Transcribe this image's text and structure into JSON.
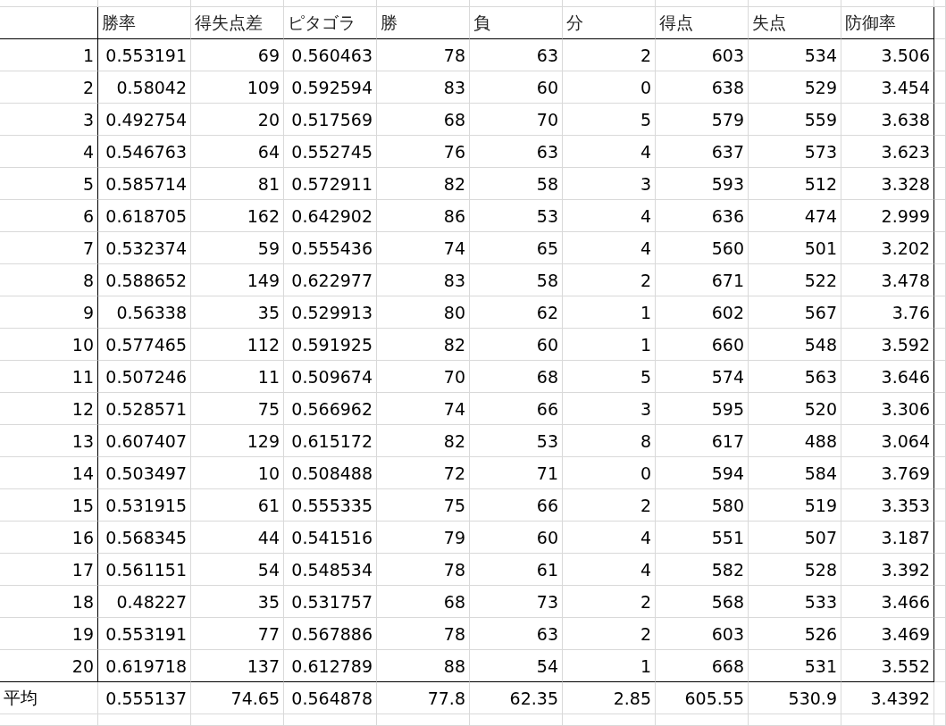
{
  "sheet": {
    "columns": [
      "勝率",
      "得失点差",
      "ピタゴラ",
      "勝",
      "負",
      "分",
      "得点",
      "失点",
      "防御率"
    ],
    "rows": [
      {
        "label": "1",
        "cells": [
          "0.553191",
          "69",
          "0.560463",
          "78",
          "63",
          "2",
          "603",
          "534",
          "3.506"
        ]
      },
      {
        "label": "2",
        "cells": [
          "0.58042",
          "109",
          "0.592594",
          "83",
          "60",
          "0",
          "638",
          "529",
          "3.454"
        ]
      },
      {
        "label": "3",
        "cells": [
          "0.492754",
          "20",
          "0.517569",
          "68",
          "70",
          "5",
          "579",
          "559",
          "3.638"
        ]
      },
      {
        "label": "4",
        "cells": [
          "0.546763",
          "64",
          "0.552745",
          "76",
          "63",
          "4",
          "637",
          "573",
          "3.623"
        ]
      },
      {
        "label": "5",
        "cells": [
          "0.585714",
          "81",
          "0.572911",
          "82",
          "58",
          "3",
          "593",
          "512",
          "3.328"
        ]
      },
      {
        "label": "6",
        "cells": [
          "0.618705",
          "162",
          "0.642902",
          "86",
          "53",
          "4",
          "636",
          "474",
          "2.999"
        ]
      },
      {
        "label": "7",
        "cells": [
          "0.532374",
          "59",
          "0.555436",
          "74",
          "65",
          "4",
          "560",
          "501",
          "3.202"
        ]
      },
      {
        "label": "8",
        "cells": [
          "0.588652",
          "149",
          "0.622977",
          "83",
          "58",
          "2",
          "671",
          "522",
          "3.478"
        ]
      },
      {
        "label": "9",
        "cells": [
          "0.56338",
          "35",
          "0.529913",
          "80",
          "62",
          "1",
          "602",
          "567",
          "3.76"
        ]
      },
      {
        "label": "10",
        "cells": [
          "0.577465",
          "112",
          "0.591925",
          "82",
          "60",
          "1",
          "660",
          "548",
          "3.592"
        ]
      },
      {
        "label": "11",
        "cells": [
          "0.507246",
          "11",
          "0.509674",
          "70",
          "68",
          "5",
          "574",
          "563",
          "3.646"
        ]
      },
      {
        "label": "12",
        "cells": [
          "0.528571",
          "75",
          "0.566962",
          "74",
          "66",
          "3",
          "595",
          "520",
          "3.306"
        ]
      },
      {
        "label": "13",
        "cells": [
          "0.607407",
          "129",
          "0.615172",
          "82",
          "53",
          "8",
          "617",
          "488",
          "3.064"
        ]
      },
      {
        "label": "14",
        "cells": [
          "0.503497",
          "10",
          "0.508488",
          "72",
          "71",
          "0",
          "594",
          "584",
          "3.769"
        ]
      },
      {
        "label": "15",
        "cells": [
          "0.531915",
          "61",
          "0.555335",
          "75",
          "66",
          "2",
          "580",
          "519",
          "3.353"
        ]
      },
      {
        "label": "16",
        "cells": [
          "0.568345",
          "44",
          "0.541516",
          "79",
          "60",
          "4",
          "551",
          "507",
          "3.187"
        ]
      },
      {
        "label": "17",
        "cells": [
          "0.561151",
          "54",
          "0.548534",
          "78",
          "61",
          "4",
          "582",
          "528",
          "3.392"
        ]
      },
      {
        "label": "18",
        "cells": [
          "0.48227",
          "35",
          "0.531757",
          "68",
          "73",
          "2",
          "568",
          "533",
          "3.466"
        ]
      },
      {
        "label": "19",
        "cells": [
          "0.553191",
          "77",
          "0.567886",
          "78",
          "63",
          "2",
          "603",
          "526",
          "3.469"
        ]
      },
      {
        "label": "20",
        "cells": [
          "0.619718",
          "137",
          "0.612789",
          "88",
          "54",
          "1",
          "668",
          "531",
          "3.552"
        ]
      }
    ],
    "average": {
      "label": "平均",
      "cells": [
        "0.555137",
        "74.65",
        "0.564878",
        "77.8",
        "62.35",
        "2.85",
        "605.55",
        "530.9",
        "3.4392"
      ]
    }
  }
}
